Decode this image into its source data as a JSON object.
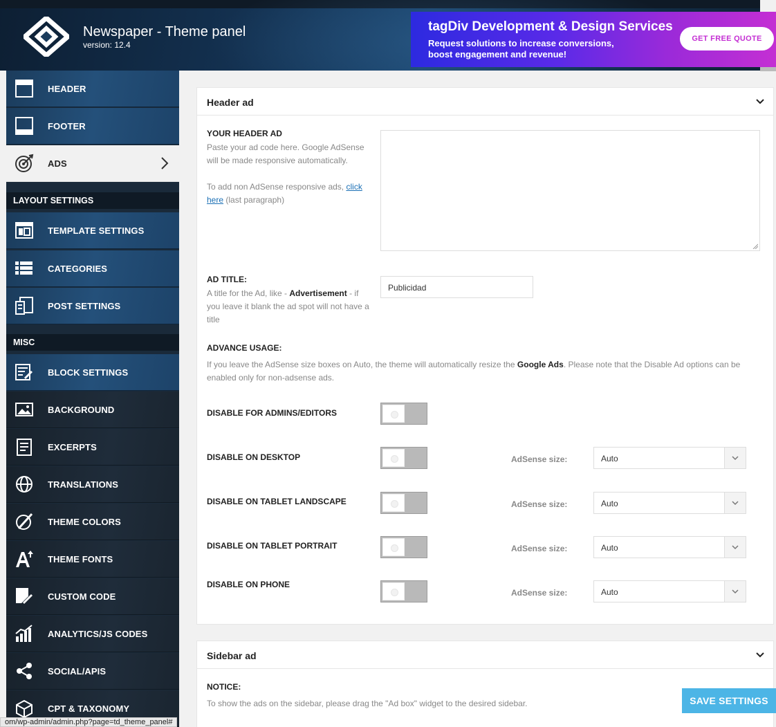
{
  "header": {
    "title": "Newspaper - Theme panel",
    "version": "version: 12.4"
  },
  "promo": {
    "title": "tagDiv Development & Design Services",
    "subtitle": "Request solutions to increase conversions, boost engagement and revenue!",
    "button": "GET FREE QUOTE"
  },
  "sidebar": {
    "items_top": [
      {
        "label": "HEADER",
        "icon": "header-icon"
      },
      {
        "label": "FOOTER",
        "icon": "footer-icon"
      },
      {
        "label": "ADS",
        "icon": "target-icon"
      }
    ],
    "section_layout": "LAYOUT SETTINGS",
    "items_layout": [
      {
        "label": "TEMPLATE SETTINGS",
        "icon": "template-icon"
      },
      {
        "label": "CATEGORIES",
        "icon": "list-icon"
      },
      {
        "label": "POST SETTINGS",
        "icon": "post-icon"
      }
    ],
    "section_misc": "MISC",
    "items_misc": [
      {
        "label": "BLOCK SETTINGS",
        "icon": "block-icon"
      },
      {
        "label": "BACKGROUND",
        "icon": "image-icon"
      },
      {
        "label": "EXCERPTS",
        "icon": "excerpt-icon"
      },
      {
        "label": "TRANSLATIONS",
        "icon": "globe-icon"
      },
      {
        "label": "THEME COLORS",
        "icon": "palette-icon"
      },
      {
        "label": "THEME FONTS",
        "icon": "font-icon"
      },
      {
        "label": "CUSTOM CODE",
        "icon": "code-icon"
      },
      {
        "label": "ANALYTICS/JS CODES",
        "icon": "analytics-icon"
      },
      {
        "label": "SOCIAL/APIS",
        "icon": "share-icon"
      },
      {
        "label": "CPT & TAXONOMY",
        "icon": "cube-icon"
      }
    ]
  },
  "header_ad": {
    "title": "Header ad",
    "your_ad_label": "YOUR HEADER AD",
    "your_ad_desc1": "Paste your ad code here. Google AdSense will be made responsive automatically.",
    "your_ad_desc2_pre": "To add non AdSense responsive ads, ",
    "your_ad_link": "click here",
    "your_ad_desc2_post": " (last paragraph)",
    "ad_title_label": "AD TITLE:",
    "ad_title_desc_pre": "A title for the Ad, like - ",
    "ad_title_desc_bold": "Advertisement",
    "ad_title_desc_post": " - if you leave it blank the ad spot will not have a title",
    "ad_title_value": "Publicidad",
    "advance_label": "ADVANCE USAGE:",
    "advance_desc_pre": "If you leave the AdSense size boxes on Auto, the theme will automatically resize the ",
    "advance_desc_bold": "Google Ads",
    "advance_desc_post": ". Please note that the Disable Ad options can be enabled only for non-adsense ads.",
    "disable_admins": "DISABLE FOR ADMINS/EDITORS",
    "adsense_label": "AdSense size:",
    "rows": [
      {
        "label": "DISABLE ON DESKTOP",
        "size": "Auto"
      },
      {
        "label": "DISABLE ON TABLET LANDSCAPE",
        "size": "Auto"
      },
      {
        "label": "DISABLE ON TABLET PORTRAIT",
        "size": "Auto"
      },
      {
        "label": "DISABLE ON PHONE",
        "size": "Auto"
      }
    ]
  },
  "sidebar_ad": {
    "title": "Sidebar ad",
    "notice_label": "NOTICE:",
    "notice_desc": "To show the ads on the sidebar, please drag the \"Ad box\" widget to the desired sidebar."
  },
  "save_button": "SAVE SETTINGS",
  "status_url": "om/wp-admin/admin.php?page=td_theme_panel#",
  "colors": {
    "accent": "#4cb5e6",
    "sidebar_blue": "#24507a",
    "promo_start": "#2d2ae0",
    "promo_end": "#c42fd3"
  }
}
